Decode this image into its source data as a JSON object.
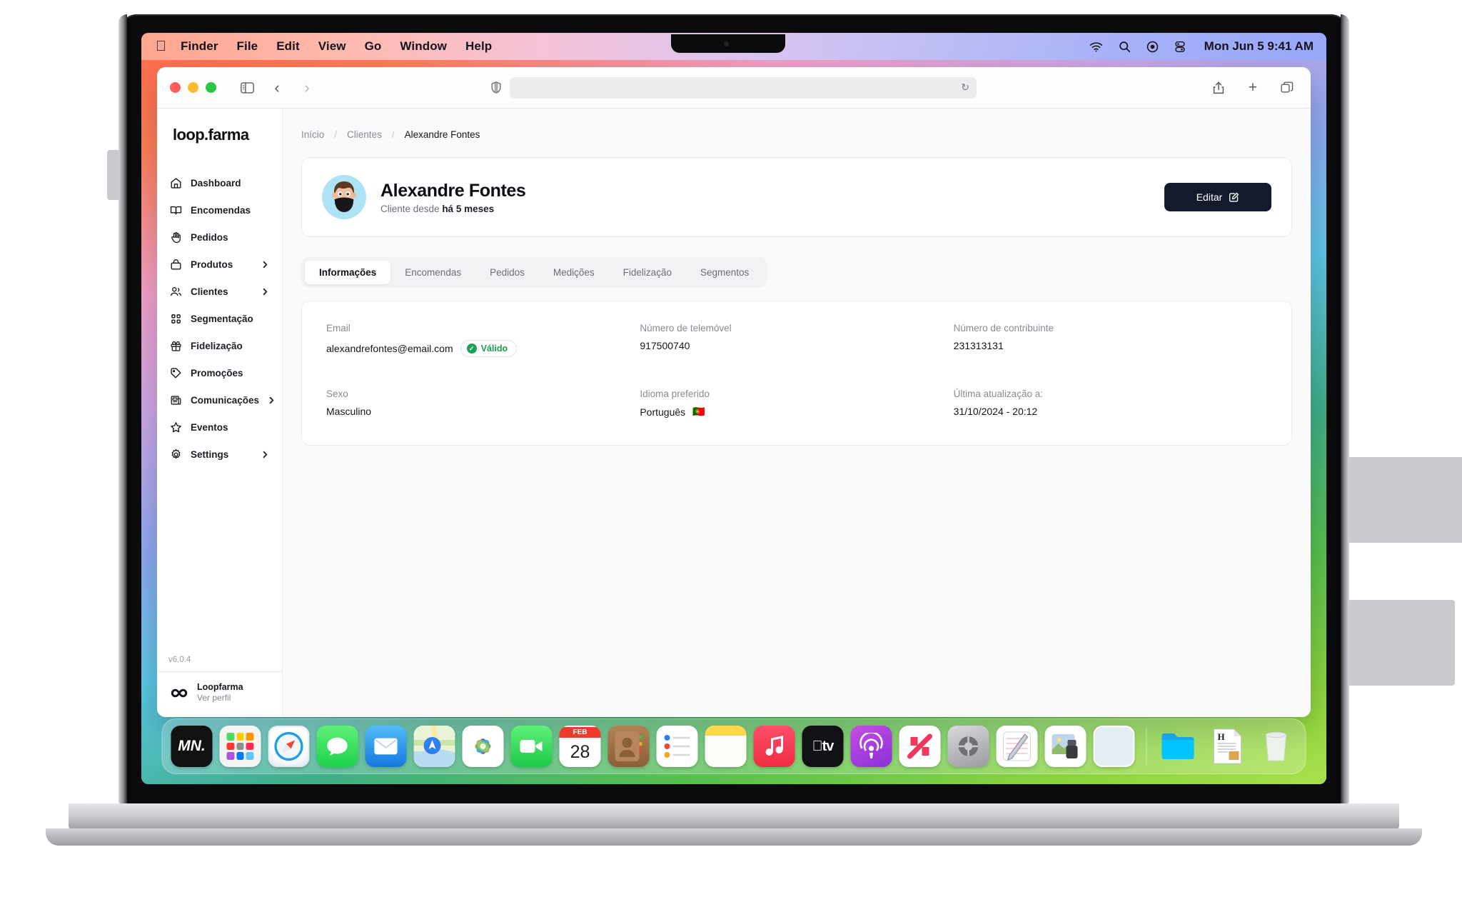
{
  "menubar": {
    "apple_glyph": "",
    "items": [
      "Finder",
      "File",
      "Edit",
      "View",
      "Go",
      "Window",
      "Help"
    ],
    "clock": "Mon Jun 5  9:41 AM",
    "status_icons": [
      "wifi-icon",
      "search-icon",
      "control-center-icon",
      "siri-icon"
    ]
  },
  "browser": {
    "url_value": "",
    "url_placeholder": "",
    "reload_glyph": "↻",
    "shield_icon": "privacy-shield-icon",
    "back_glyph": "‹",
    "forward_glyph": "›",
    "sidebar_toggle_icon": "sidebar-toggle-icon",
    "share_glyph": "↥",
    "new_tab_glyph": "+",
    "tabs_glyph": "tabs-overview-icon"
  },
  "sidebar": {
    "brand": "loop.farma",
    "version": "v6.0.4",
    "items": [
      {
        "label": "Dashboard",
        "icon": "home-icon",
        "expandable": false
      },
      {
        "label": "Encomendas",
        "icon": "book-icon",
        "expandable": false
      },
      {
        "label": "Pedidos",
        "icon": "hand-icon",
        "expandable": false
      },
      {
        "label": "Produtos",
        "icon": "box-icon",
        "expandable": true
      },
      {
        "label": "Clientes",
        "icon": "users-icon",
        "expandable": true
      },
      {
        "label": "Segmentação",
        "icon": "grid-dots-icon",
        "expandable": false
      },
      {
        "label": "Fidelização",
        "icon": "gift-icon",
        "expandable": false
      },
      {
        "label": "Promoções",
        "icon": "tag-icon",
        "expandable": false
      },
      {
        "label": "Comunicações",
        "icon": "newspaper-icon",
        "expandable": true
      },
      {
        "label": "Eventos",
        "icon": "star-icon",
        "expandable": false
      },
      {
        "label": "Settings",
        "icon": "gear-icon",
        "expandable": true
      }
    ],
    "footer": {
      "avatar_icon": "infinity-icon",
      "name": "Loopfarma",
      "subtitle": "Ver perfil"
    }
  },
  "breadcrumb": {
    "home": "Início",
    "sep": "/",
    "section": "Clientes",
    "current": "Alexandre Fontes"
  },
  "profile": {
    "avatar_icon": "user-memoji-avatar",
    "name": "Alexandre Fontes",
    "since_prefix": "Cliente desde ",
    "since_value": "há 5 meses",
    "edit_label": "Editar",
    "edit_icon": "edit-pencil-icon"
  },
  "tabs": [
    {
      "label": "Informações",
      "active": true
    },
    {
      "label": "Encomendas",
      "active": false
    },
    {
      "label": "Pedidos",
      "active": false
    },
    {
      "label": "Medições",
      "active": false
    },
    {
      "label": "Fidelização",
      "active": false
    },
    {
      "label": "Segmentos",
      "active": false
    }
  ],
  "info_fields": [
    {
      "label": "Email",
      "value": "alexandrefontes@email.com",
      "badge": "Válido",
      "badge_icon": "check-circle-icon"
    },
    {
      "label": "Número de telemóvel",
      "value": "917500740"
    },
    {
      "label": "Número de contribuinte",
      "value": "231313131"
    },
    {
      "label": "Sexo",
      "value": "Masculino"
    },
    {
      "label": "Idioma preferido",
      "value": "Português",
      "flag": "🇵🇹"
    },
    {
      "label": "Última atualização a:",
      "value": "31/10/2024 - 20:12"
    }
  ],
  "dock": {
    "items": [
      {
        "name": "mn-app-icon",
        "label": "MN."
      },
      {
        "name": "launchpad-icon",
        "label": ""
      },
      {
        "name": "safari-icon",
        "label": ""
      },
      {
        "name": "messages-icon",
        "label": ""
      },
      {
        "name": "mail-icon",
        "label": ""
      },
      {
        "name": "maps-icon",
        "label": ""
      },
      {
        "name": "photos-icon",
        "label": ""
      },
      {
        "name": "facetime-icon",
        "label": ""
      },
      {
        "name": "calendar-icon",
        "label": "28",
        "month": "FEB"
      },
      {
        "name": "contacts-icon",
        "label": ""
      },
      {
        "name": "reminders-icon",
        "label": ""
      },
      {
        "name": "notes-icon",
        "label": ""
      },
      {
        "name": "music-icon",
        "label": ""
      },
      {
        "name": "appletv-icon",
        "label": "tv"
      },
      {
        "name": "podcasts-icon",
        "label": ""
      },
      {
        "name": "news-icon",
        "label": ""
      },
      {
        "name": "system-settings-icon",
        "label": ""
      },
      {
        "name": "textedit-icon",
        "label": ""
      },
      {
        "name": "preview-icon",
        "label": ""
      },
      {
        "name": "placeholder-app-icon",
        "label": ""
      },
      {
        "name": "finder-folder-icon",
        "label": ""
      },
      {
        "name": "document-icon",
        "label": "H"
      },
      {
        "name": "trash-icon",
        "label": ""
      }
    ]
  },
  "colors": {
    "accent_dark": "#131a2c",
    "valid_green": "#1ea055",
    "avatar_bg": "#aee2f5",
    "sidebar_border": "#ececee"
  }
}
